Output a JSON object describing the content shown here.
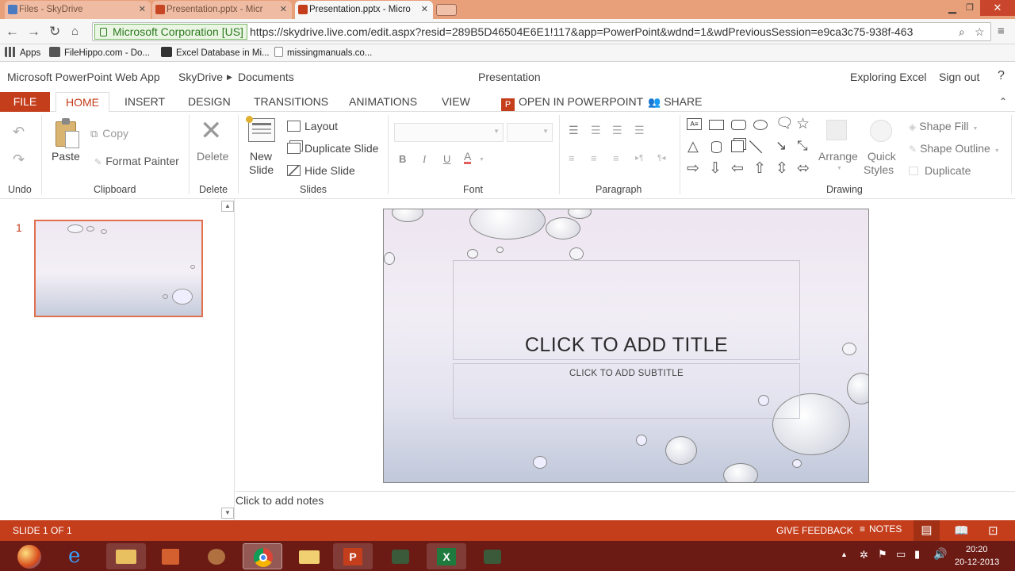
{
  "browser": {
    "tabs": [
      {
        "label": "Files - SkyDrive",
        "active": false
      },
      {
        "label": "Presentation.pptx - Micr",
        "active": false
      },
      {
        "label": "Presentation.pptx - Micro",
        "active": true
      }
    ],
    "ev_label": "Microsoft Corporation [US]",
    "url": "https://skydrive.live.com/edit.aspx?resid=289B5D46504E6E1!117&app=PowerPoint&wdnd=1&wdPreviousSession=e9ca3c75-938f-463",
    "bookmarks": [
      "Apps",
      "FileHippo.com - Do...",
      "Excel Database in Mi...",
      "missingmanuals.co..."
    ]
  },
  "app": {
    "name": "Microsoft PowerPoint Web App",
    "breadcrumb": [
      "SkyDrive",
      "Documents"
    ],
    "doc_title": "Presentation",
    "user": "Exploring Excel",
    "sign_out": "Sign out",
    "help": "?"
  },
  "ribbon": {
    "tabs": [
      "FILE",
      "HOME",
      "INSERT",
      "DESIGN",
      "TRANSITIONS",
      "ANIMATIONS",
      "VIEW"
    ],
    "open_in": "OPEN IN POWERPOINT",
    "share": "SHARE",
    "clipboard": {
      "paste": "Paste",
      "copy": "Copy",
      "format_painter": "Format Painter"
    },
    "delete": "Delete",
    "slides": {
      "new_slide_1": "New",
      "new_slide_2": "Slide",
      "layout": "Layout",
      "duplicate": "Duplicate Slide",
      "hide": "Hide Slide"
    },
    "font": {
      "bold": "B",
      "italic": "I",
      "underline": "U",
      "color": "A"
    },
    "drawing": {
      "arrange": "Arrange",
      "quick_styles_1": "Quick",
      "quick_styles_2": "Styles",
      "shape_fill": "Shape Fill",
      "shape_outline": "Shape Outline",
      "duplicate": "Duplicate"
    },
    "groups": [
      "Undo",
      "Clipboard",
      "Delete",
      "Slides",
      "Font",
      "Paragraph",
      "Drawing"
    ]
  },
  "thumbs": [
    {
      "number": "1"
    }
  ],
  "slide": {
    "title": "CLICK TO ADD TITLE",
    "subtitle": "CLICK TO ADD SUBTITLE"
  },
  "notes_placeholder": "Click to add notes",
  "status": {
    "slide_count": "SLIDE 1 OF 1",
    "feedback": "GIVE FEEDBACK",
    "notes": "NOTES"
  },
  "taskbar": {
    "time": "20:20",
    "date": "20-12-2013"
  },
  "colors": {
    "accent": "#c43e1c",
    "taskbar": "#6b1a14",
    "ev_green": "#2c7a1e"
  }
}
